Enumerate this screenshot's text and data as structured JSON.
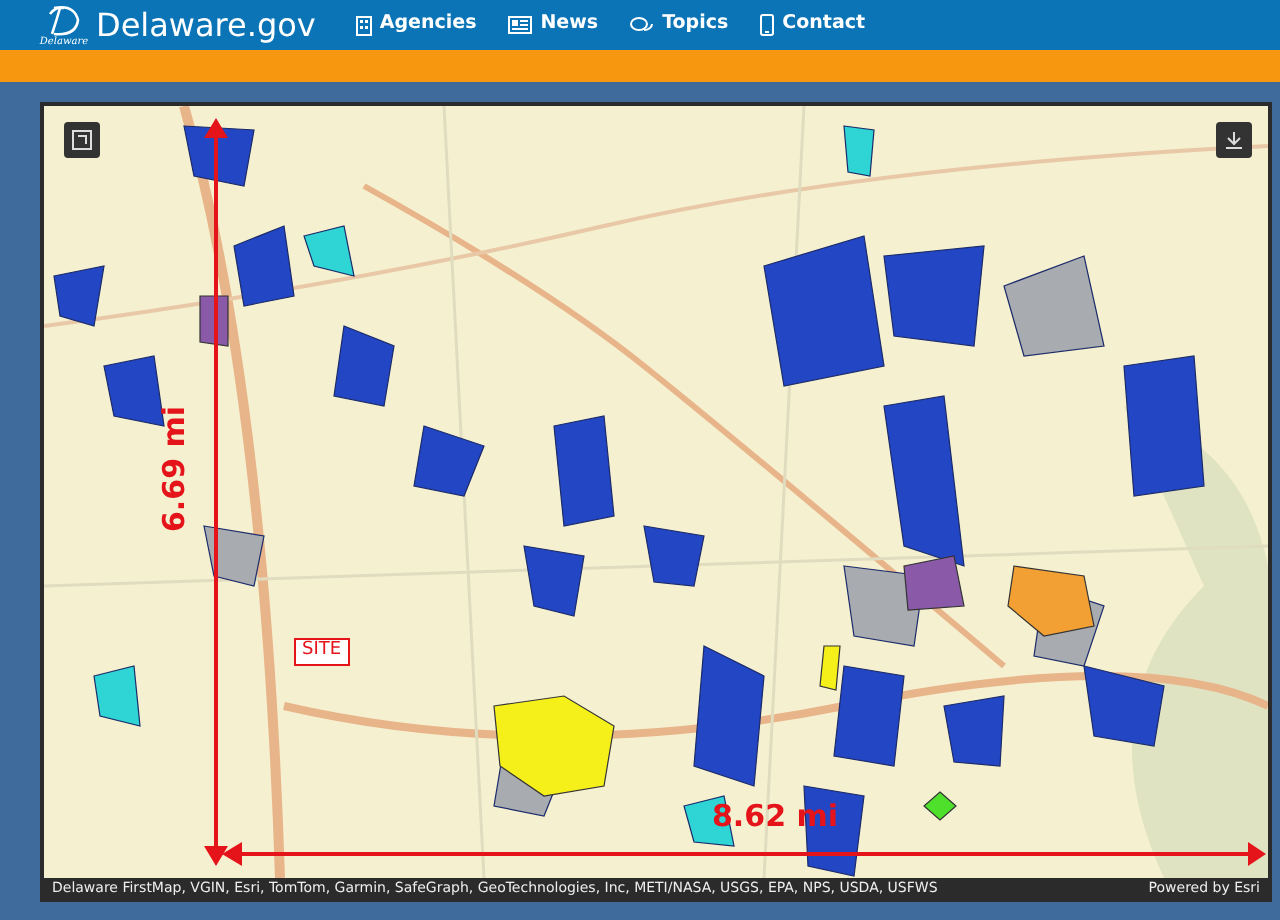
{
  "header": {
    "site_title": "Delaware.gov",
    "logo_caption": "Delaware",
    "nav": [
      {
        "label": "Agencies"
      },
      {
        "label": "News"
      },
      {
        "label": "Topics"
      },
      {
        "label": "Contact"
      }
    ]
  },
  "map": {
    "site_label": "SITE",
    "vertical_measure": "6.69 mi",
    "horizontal_measure": "8.62 mi",
    "attribution": "Delaware FirstMap, VGIN, Esri, TomTom, Garmin, SafeGraph, GeoTechnologies, Inc, METI/NASA, USGS, EPA, NPS, USDA, USFWS",
    "powered_by": "Powered by Esri"
  }
}
